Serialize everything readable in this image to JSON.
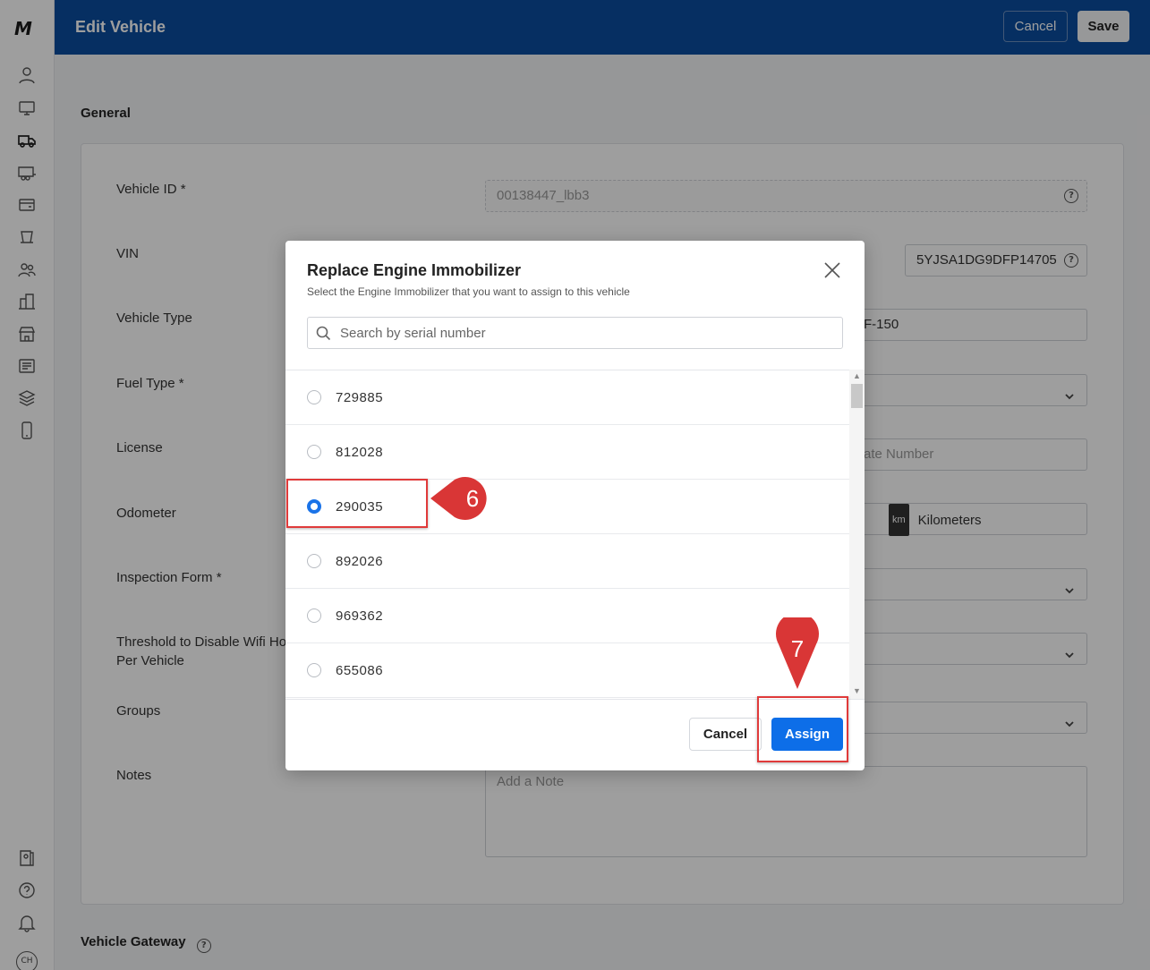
{
  "header": {
    "title": "Edit Vehicle",
    "cancel_label": "Cancel",
    "save_label": "Save"
  },
  "sidebar": {
    "logo": "M",
    "avatar_initials": "CH"
  },
  "general": {
    "section_title": "General",
    "fields": {
      "vehicle_id": {
        "label": "Vehicle ID *",
        "value": "00138447_lbb3"
      },
      "vin": {
        "label": "VIN",
        "value": "5YJSA1DG9DFP14705"
      },
      "vehicle_type": {
        "label": "Vehicle Type",
        "value": "F-150"
      },
      "fuel_type": {
        "label": "Fuel Type *"
      },
      "license": {
        "label": "License",
        "placeholder": "ate Number"
      },
      "odometer": {
        "label": "Odometer",
        "unit_badge": "km",
        "unit": "Kilometers"
      },
      "inspection_form": {
        "label": "Inspection Form *"
      },
      "wifi_threshold": {
        "label_line1": "Threshold to Disable Wifi Ho",
        "label_line2": "Per Vehicle"
      },
      "groups": {
        "label": "Groups"
      },
      "notes": {
        "label": "Notes",
        "placeholder": "Add a Note"
      }
    },
    "vehicle_gateway_title": "Vehicle Gateway"
  },
  "modal": {
    "title": "Replace Engine Immobilizer",
    "subtitle": "Select the Engine Immobilizer that you want to assign to this vehicle",
    "search_placeholder": "Search by serial number",
    "items": [
      {
        "serial": "729885",
        "selected": false
      },
      {
        "serial": "812028",
        "selected": false
      },
      {
        "serial": "290035",
        "selected": true
      },
      {
        "serial": "892026",
        "selected": false
      },
      {
        "serial": "969362",
        "selected": false
      },
      {
        "serial": "655086",
        "selected": false
      }
    ],
    "cancel_label": "Cancel",
    "assign_label": "Assign"
  },
  "annotations": {
    "step_6": "6",
    "step_7": "7",
    "color": "#d93636"
  }
}
